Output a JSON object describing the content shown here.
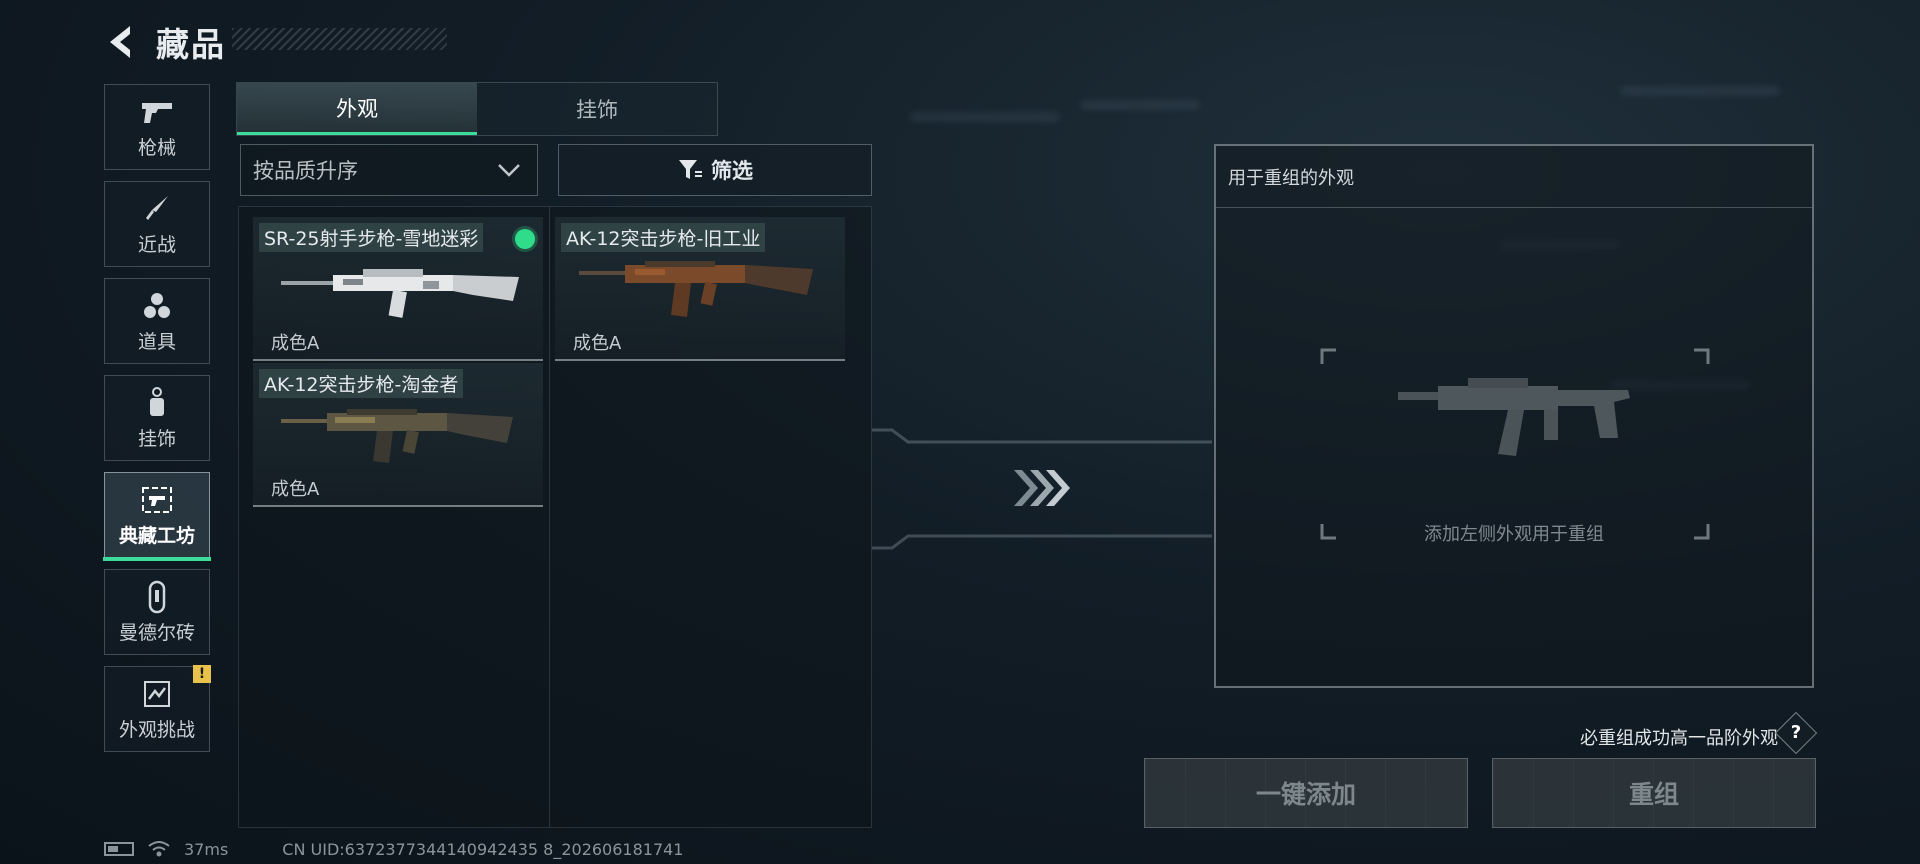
{
  "header": {
    "title": "藏品"
  },
  "sidebar": {
    "items": [
      {
        "label": "枪械",
        "icon": "pistol-icon"
      },
      {
        "label": "近战",
        "icon": "knife-icon"
      },
      {
        "label": "道具",
        "icon": "grenade-cluster-icon"
      },
      {
        "label": "挂饰",
        "icon": "charm-icon"
      },
      {
        "label": "典藏工坊",
        "icon": "workshop-icon",
        "active": true
      },
      {
        "label": "曼德尔砖",
        "icon": "mandel-brick-icon"
      },
      {
        "label": "外观挑战",
        "icon": "challenge-icon",
        "badge": "!"
      }
    ]
  },
  "tabs": [
    {
      "label": "外观",
      "active": true
    },
    {
      "label": "挂饰",
      "active": false
    }
  ],
  "sort": {
    "selected": "按品质升序"
  },
  "filter": {
    "label": "筛选"
  },
  "items": [
    {
      "name": "SR-25射手步枪-雪地迷彩",
      "condition": "成色A",
      "selected": true
    },
    {
      "name": "AK-12突击步枪-旧工业",
      "condition": "成色A",
      "selected": false
    },
    {
      "name": "AK-12突击步枪-淘金者",
      "condition": "成色A",
      "selected": false
    }
  ],
  "recombine": {
    "header": "用于重组的外观",
    "hint": "添加左侧外观用于重组",
    "note": "必重组成功高一品阶外观",
    "help": "?",
    "add_all_label": "一键添加",
    "recombine_label": "重组"
  },
  "status": {
    "latency": "37ms",
    "uid": "CN UID:6372377344140942435 8_202606181741"
  },
  "colors": {
    "accent": "#3ddc9a",
    "warning": "#e8c24a",
    "bg": "#121d26"
  }
}
